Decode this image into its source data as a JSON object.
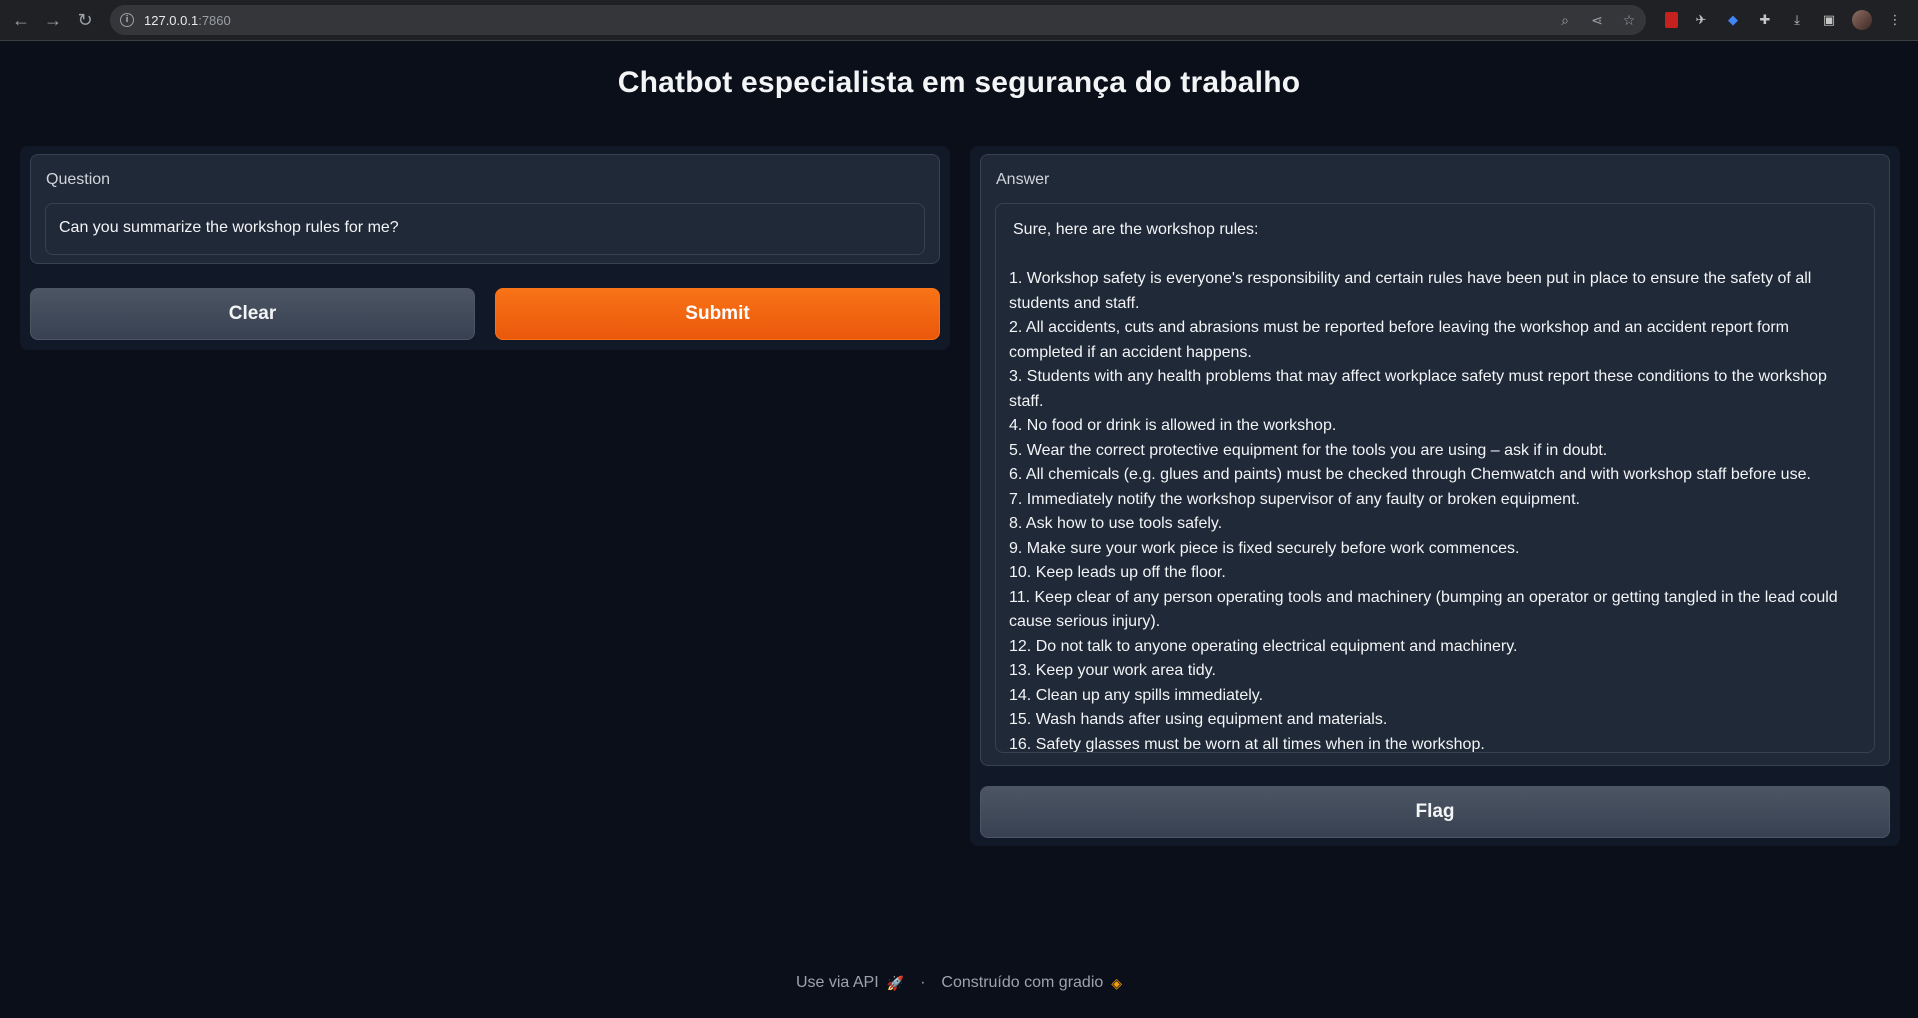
{
  "browser": {
    "url_host": "127.0.0.1",
    "url_port": ":7860"
  },
  "page": {
    "title": "Chatbot especialista em segurança do trabalho"
  },
  "question": {
    "label": "Question",
    "value": "Can you summarize the workshop rules for me?"
  },
  "buttons": {
    "clear": "Clear",
    "submit": "Submit",
    "flag": "Flag"
  },
  "answer": {
    "label": "Answer",
    "intro": "Sure, here are the workshop rules:",
    "lines": [
      "1. Workshop safety is everyone's responsibility and certain rules have been put in place to ensure the safety of all students and staff.",
      "2. All accidents, cuts and abrasions must be reported before leaving the workshop and an accident report form completed if an accident happens.",
      "3. Students with any health problems that may affect workplace safety must report these conditions to the workshop staff.",
      "4. No food or drink is allowed in the workshop.",
      "5. Wear the correct protective equipment for the tools you are using – ask if in doubt.",
      "6. All chemicals (e.g. glues and paints) must be checked through Chemwatch and with workshop staff before use.",
      "7. Immediately notify the workshop supervisor of any faulty or broken equipment.",
      "8. Ask how to use tools safely.",
      "9. Make sure your work piece is fixed securely before work commences.",
      "10. Keep leads up off the floor.",
      "11. Keep clear of any person operating tools and machinery (bumping an operator or getting tangled in the lead could cause serious injury).",
      "12. Do not talk to anyone operating electrical equipment and machinery.",
      "13. Keep your work area tidy.",
      "14. Clean up any spills immediately.",
      "15. Wash hands after using equipment and materials.",
      "16. Safety glasses must be worn at all times when in the workshop."
    ]
  },
  "footer": {
    "api_link": "Use via API",
    "separator": "·",
    "built_with": "Construído com gradio"
  },
  "colors": {
    "background": "#0b0f19",
    "panel": "#111827",
    "block": "#1f2937",
    "accent": "#f97316"
  }
}
